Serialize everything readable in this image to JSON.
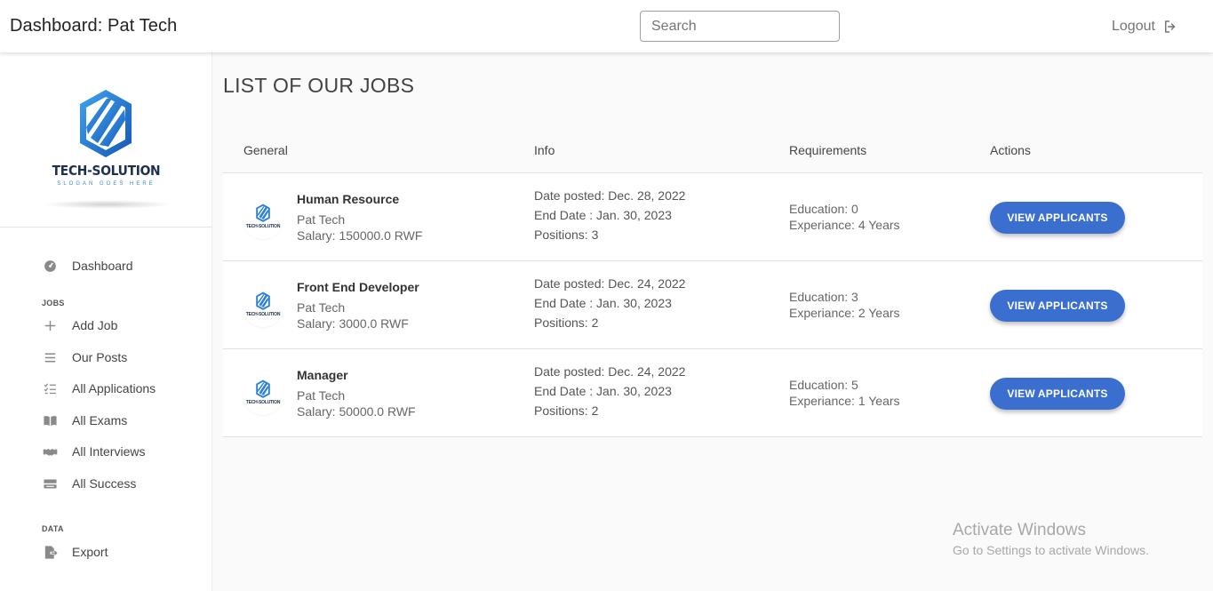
{
  "header": {
    "title": "Dashboard: Pat Tech",
    "search_placeholder": "Search",
    "logout_label": "Logout"
  },
  "sidebar": {
    "logo": {
      "name": "TECH-SOLUTION",
      "slogan": "SLOGAN GOES HERE"
    },
    "items": [
      {
        "label": "Dashboard",
        "icon": "dashboard-icon"
      },
      {
        "label": "Add Job",
        "icon": "plus-icon"
      },
      {
        "label": "Our Posts",
        "icon": "list-icon"
      },
      {
        "label": "All Applications",
        "icon": "checklist-icon"
      },
      {
        "label": "All Exams",
        "icon": "book-icon"
      },
      {
        "label": "All Interviews",
        "icon": "handshake-icon"
      },
      {
        "label": "All Success",
        "icon": "ticket-icon"
      },
      {
        "label": "Export",
        "icon": "export-icon"
      }
    ],
    "sections": {
      "jobs": "JOBS",
      "data": "DATA"
    }
  },
  "main": {
    "title": "LIST OF OUR JOBS",
    "columns": [
      "General",
      "Info",
      "Requirements",
      "Actions"
    ],
    "jobs": [
      {
        "title": "Human Resource",
        "company": "Pat Tech",
        "salary": "Salary: 150000.0 RWF",
        "date_posted": "Date posted: Dec. 28, 2022",
        "end_date": "End Date : Jan. 30, 2023",
        "positions": "Positions: 3",
        "education": "Education: 0",
        "experience": "Experiance: 4 Years",
        "action": "VIEW APPLICANTS"
      },
      {
        "title": "Front End Developer",
        "company": "Pat Tech",
        "salary": "Salary: 3000.0 RWF",
        "date_posted": "Date posted: Dec. 24, 2022",
        "end_date": "End Date : Jan. 30, 2023",
        "positions": "Positions: 2",
        "education": "Education: 3",
        "experience": "Experiance: 2 Years",
        "action": "VIEW APPLICANTS"
      },
      {
        "title": "Manager",
        "company": "Pat Tech",
        "salary": "Salary: 50000.0 RWF",
        "date_posted": "Date posted: Dec. 24, 2022",
        "end_date": "End Date : Jan. 30, 2023",
        "positions": "Positions: 2",
        "education": "Education: 5",
        "experience": "Experiance: 1 Years",
        "action": "VIEW APPLICANTS"
      }
    ]
  },
  "watermark": {
    "title": "Activate Windows",
    "subtitle": "Go to Settings to activate Windows."
  },
  "colors": {
    "accent": "#3a6fcf",
    "logo_blue": "#1e6fd0",
    "logo_text": "#1f2f4f"
  }
}
